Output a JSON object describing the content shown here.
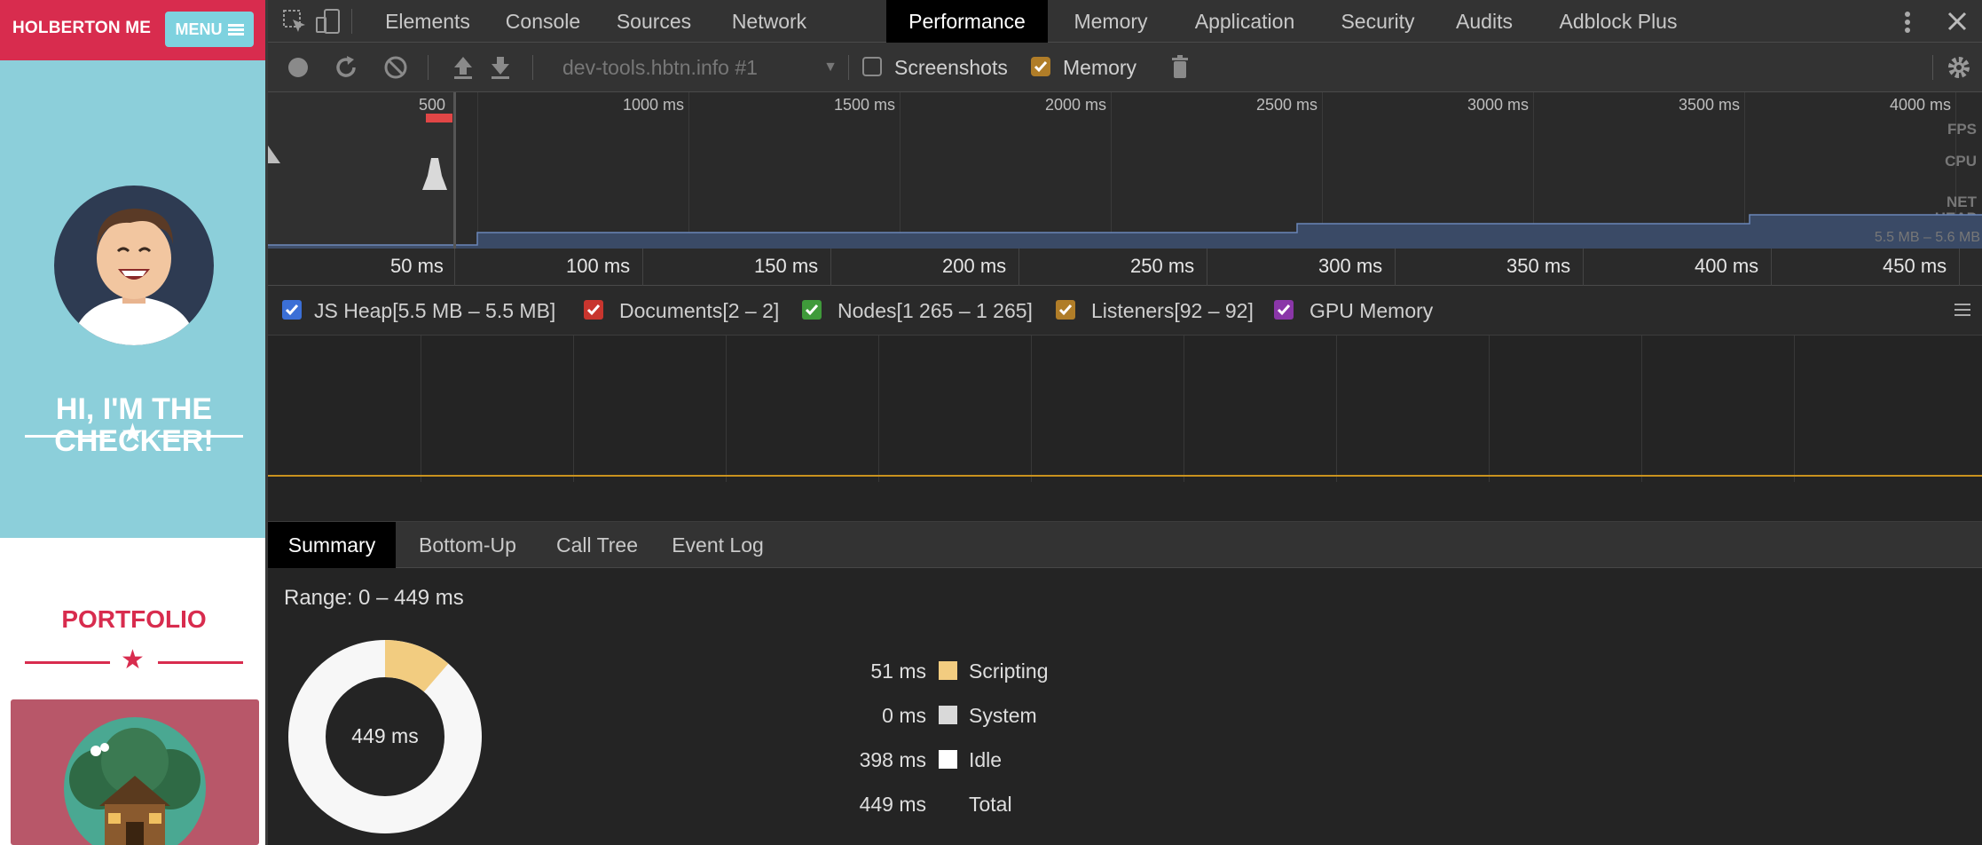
{
  "site": {
    "brand": "HOLBERTON ME",
    "menu_label": "MENU",
    "hero_line1": "HI, I'M THE",
    "hero_line2": "CHECKER!",
    "portfolio_title": "PORTFOLIO",
    "colors": {
      "nav": "#d82c4e",
      "hero": "#8ccfda",
      "accent": "#d82c4e"
    }
  },
  "devtools": {
    "tabs": [
      {
        "label": "Elements"
      },
      {
        "label": "Console"
      },
      {
        "label": "Sources"
      },
      {
        "label": "Network"
      },
      {
        "label": "Performance",
        "active": true
      },
      {
        "label": "Memory"
      },
      {
        "label": "Application"
      },
      {
        "label": "Security"
      },
      {
        "label": "Audits"
      },
      {
        "label": "Adblock Plus"
      }
    ],
    "toolbar": {
      "profile": "dev-tools.hbtn.info #1",
      "screenshots_label": "Screenshots",
      "screenshots_checked": false,
      "memory_label": "Memory",
      "memory_checked": true
    },
    "overview": {
      "ticks": [
        "500",
        "1000 ms",
        "1500 ms",
        "2000 ms",
        "2500 ms",
        "3000 ms",
        "3500 ms",
        "4000 ms"
      ],
      "tracks": [
        "FPS",
        "CPU",
        "NET",
        "HEAP"
      ],
      "heap_range": "5.5 MB – 5.6 MB"
    },
    "ruler": [
      "50 ms",
      "100 ms",
      "150 ms",
      "200 ms",
      "250 ms",
      "300 ms",
      "350 ms",
      "400 ms",
      "450 ms"
    ],
    "counters": [
      {
        "label": "JS Heap[5.5 MB – 5.5 MB]",
        "color": "#3b6fd6"
      },
      {
        "label": "Documents[2 – 2]",
        "color": "#c8352e"
      },
      {
        "label": "Nodes[1 265 – 1 265]",
        "color": "#3f9a3a"
      },
      {
        "label": "Listeners[92 – 92]",
        "color": "#b07d28"
      },
      {
        "label": "GPU Memory",
        "color": "#8a36a8"
      }
    ],
    "bottom_tabs": [
      {
        "label": "Summary",
        "active": true
      },
      {
        "label": "Bottom-Up"
      },
      {
        "label": "Call Tree"
      },
      {
        "label": "Event Log"
      }
    ],
    "summary": {
      "range": "Range: 0 – 449 ms",
      "total_center": "449 ms",
      "legend": [
        {
          "value": "51 ms",
          "name": "Scripting",
          "color": "#f2cc80"
        },
        {
          "value": "0 ms",
          "name": "System",
          "color": "#d9d9d9"
        },
        {
          "value": "398 ms",
          "name": "Idle",
          "color": "#ffffff"
        },
        {
          "value": "449 ms",
          "name": "Total",
          "color": ""
        }
      ]
    }
  }
}
